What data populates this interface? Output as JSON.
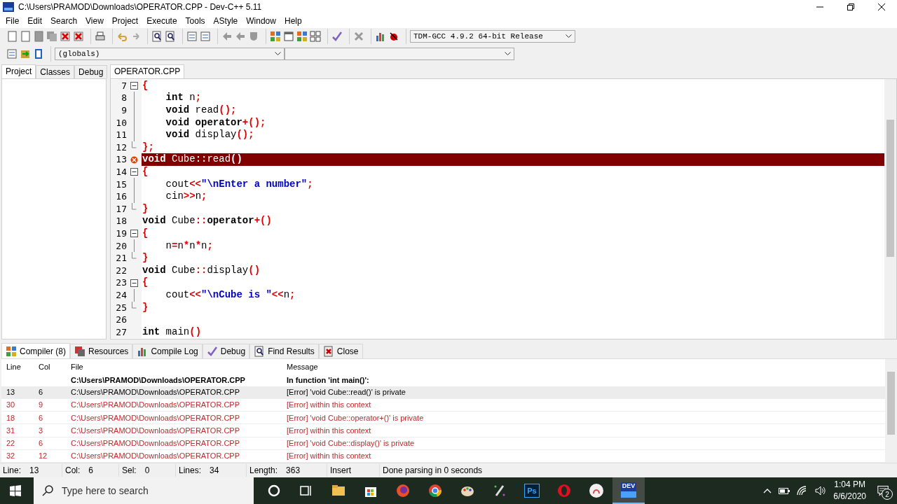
{
  "window": {
    "title": "C:\\Users\\PRAMOD\\Downloads\\OPERATOR.CPP - Dev-C++ 5.11"
  },
  "menu": [
    "File",
    "Edit",
    "Search",
    "View",
    "Project",
    "Execute",
    "Tools",
    "AStyle",
    "Window",
    "Help"
  ],
  "compiler_select": {
    "value": "TDM-GCC 4.9.2 64-bit Release"
  },
  "scope_select": {
    "value": "(globals)"
  },
  "side_tabs": [
    {
      "label": "Project",
      "selected": true
    },
    {
      "label": "Classes",
      "selected": false
    },
    {
      "label": "Debug",
      "selected": false
    }
  ],
  "editor_tabs": [
    {
      "label": "OPERATOR.CPP",
      "selected": true
    }
  ],
  "code_lines": [
    {
      "number": "7",
      "kind": "start",
      "selected": false,
      "tokens": [
        {
          "kind": "sym",
          "text": "{"
        }
      ]
    },
    {
      "number": "8",
      "kind": "mid",
      "selected": false,
      "tokens": [
        {
          "kind": "kw",
          "text": "    int"
        },
        {
          "kind": "plain",
          "text": " n"
        },
        {
          "kind": "sym",
          "text": ";"
        }
      ]
    },
    {
      "number": "9",
      "kind": "mid",
      "selected": false,
      "tokens": [
        {
          "kind": "kw",
          "text": "    void"
        },
        {
          "kind": "plain",
          "text": " read"
        },
        {
          "kind": "sym",
          "text": "();"
        }
      ]
    },
    {
      "number": "10",
      "kind": "mid",
      "selected": false,
      "tokens": [
        {
          "kind": "kw",
          "text": "    void"
        },
        {
          "kind": "kw",
          "text": " operator"
        },
        {
          "kind": "sym",
          "text": "+();"
        }
      ]
    },
    {
      "number": "11",
      "kind": "mid",
      "selected": false,
      "tokens": [
        {
          "kind": "kw",
          "text": "    void"
        },
        {
          "kind": "plain",
          "text": " display"
        },
        {
          "kind": "sym",
          "text": "();"
        }
      ]
    },
    {
      "number": "12",
      "kind": "end",
      "selected": false,
      "tokens": [
        {
          "kind": "sym",
          "text": "};"
        }
      ]
    },
    {
      "number": "13",
      "kind": "plain",
      "selected": true,
      "error": true,
      "tokens": [
        {
          "kind": "kw",
          "text": "void"
        },
        {
          "kind": "plain",
          "text": " Cube"
        },
        {
          "kind": "sym",
          "text": "::"
        },
        {
          "kind": "plain",
          "text": "read"
        },
        {
          "kind": "sym",
          "text": "()"
        }
      ]
    },
    {
      "number": "14",
      "kind": "start",
      "selected": false,
      "tokens": [
        {
          "kind": "sym",
          "text": "{"
        }
      ]
    },
    {
      "number": "15",
      "kind": "mid",
      "selected": false,
      "tokens": [
        {
          "kind": "plain",
          "text": "    cout"
        },
        {
          "kind": "sym",
          "text": "<<"
        },
        {
          "kind": "str",
          "text": "\"\\nEnter a number\""
        },
        {
          "kind": "sym",
          "text": ";"
        }
      ]
    },
    {
      "number": "16",
      "kind": "mid",
      "selected": false,
      "tokens": [
        {
          "kind": "plain",
          "text": "    cin"
        },
        {
          "kind": "sym",
          "text": ">>"
        },
        {
          "kind": "plain",
          "text": "n"
        },
        {
          "kind": "sym",
          "text": ";"
        }
      ]
    },
    {
      "number": "17",
      "kind": "end",
      "selected": false,
      "tokens": [
        {
          "kind": "sym",
          "text": "}"
        }
      ]
    },
    {
      "number": "18",
      "kind": "plain",
      "selected": false,
      "tokens": [
        {
          "kind": "kw",
          "text": "void"
        },
        {
          "kind": "plain",
          "text": " Cube"
        },
        {
          "kind": "sym",
          "text": "::"
        },
        {
          "kind": "kw",
          "text": "operator"
        },
        {
          "kind": "sym",
          "text": "+()"
        }
      ]
    },
    {
      "number": "19",
      "kind": "start",
      "selected": false,
      "tokens": [
        {
          "kind": "sym",
          "text": "{"
        }
      ]
    },
    {
      "number": "20",
      "kind": "mid",
      "selected": false,
      "tokens": [
        {
          "kind": "plain",
          "text": "    n"
        },
        {
          "kind": "sym",
          "text": "="
        },
        {
          "kind": "plain",
          "text": "n"
        },
        {
          "kind": "sym",
          "text": "*"
        },
        {
          "kind": "plain",
          "text": "n"
        },
        {
          "kind": "sym",
          "text": "*"
        },
        {
          "kind": "plain",
          "text": "n"
        },
        {
          "kind": "sym",
          "text": ";"
        }
      ]
    },
    {
      "number": "21",
      "kind": "end",
      "selected": false,
      "tokens": [
        {
          "kind": "sym",
          "text": "}"
        }
      ]
    },
    {
      "number": "22",
      "kind": "plain",
      "selected": false,
      "tokens": [
        {
          "kind": "kw",
          "text": "void"
        },
        {
          "kind": "plain",
          "text": " Cube"
        },
        {
          "kind": "sym",
          "text": "::"
        },
        {
          "kind": "plain",
          "text": "display"
        },
        {
          "kind": "sym",
          "text": "()"
        }
      ]
    },
    {
      "number": "23",
      "kind": "start",
      "selected": false,
      "tokens": [
        {
          "kind": "sym",
          "text": "{"
        }
      ]
    },
    {
      "number": "24",
      "kind": "mid",
      "selected": false,
      "tokens": [
        {
          "kind": "plain",
          "text": "    cout"
        },
        {
          "kind": "sym",
          "text": "<<"
        },
        {
          "kind": "str",
          "text": "\"\\nCube is \""
        },
        {
          "kind": "sym",
          "text": "<<"
        },
        {
          "kind": "plain",
          "text": "n"
        },
        {
          "kind": "sym",
          "text": ";"
        }
      ]
    },
    {
      "number": "25",
      "kind": "end",
      "selected": false,
      "tokens": [
        {
          "kind": "sym",
          "text": "}"
        }
      ]
    },
    {
      "number": "26",
      "kind": "plain",
      "selected": false
    },
    {
      "number": "27",
      "kind": "plain",
      "selected": false,
      "tokens": [
        {
          "kind": "kw",
          "text": "int"
        },
        {
          "kind": "plain",
          "text": " main"
        },
        {
          "kind": "sym",
          "text": "()"
        }
      ]
    }
  ],
  "bottom_tabs": [
    {
      "label": "Compiler (8)",
      "selected": true
    },
    {
      "label": "Resources",
      "selected": false
    },
    {
      "label": "Compile Log",
      "selected": false
    },
    {
      "label": "Debug",
      "selected": false
    },
    {
      "label": "Find Results",
      "selected": false
    },
    {
      "label": "Close",
      "selected": false
    }
  ],
  "messages": {
    "columns": [
      "Line",
      "Col",
      "File",
      "Message"
    ],
    "rows": [
      {
        "kind": "header",
        "file": "C:\\Users\\PRAMOD\\Downloads\\OPERATOR.CPP",
        "message": "In function 'int main()':",
        "selected": false
      },
      {
        "kind": "error",
        "line": "13",
        "col": "6",
        "file": "C:\\Users\\PRAMOD\\Downloads\\OPERATOR.CPP",
        "message": "[Error] 'void Cube::read()' is private",
        "selected": true
      },
      {
        "kind": "error",
        "line": "30",
        "col": "9",
        "file": "C:\\Users\\PRAMOD\\Downloads\\OPERATOR.CPP",
        "message": "[Error] within this context",
        "selected": false
      },
      {
        "kind": "error",
        "line": "18",
        "col": "6",
        "file": "C:\\Users\\PRAMOD\\Downloads\\OPERATOR.CPP",
        "message": "[Error] 'void Cube::operator+()' is private",
        "selected": false
      },
      {
        "kind": "error",
        "line": "31",
        "col": "3",
        "file": "C:\\Users\\PRAMOD\\Downloads\\OPERATOR.CPP",
        "message": "[Error] within this context",
        "selected": false
      },
      {
        "kind": "error",
        "line": "22",
        "col": "6",
        "file": "C:\\Users\\PRAMOD\\Downloads\\OPERATOR.CPP",
        "message": "[Error] 'void Cube::display()' is private",
        "selected": false
      },
      {
        "kind": "error",
        "line": "32",
        "col": "12",
        "file": "C:\\Users\\PRAMOD\\Downloads\\OPERATOR.CPP",
        "message": "[Error] within this context",
        "selected": false
      }
    ]
  },
  "status_bar": [
    {
      "label": "Line:",
      "value": "13"
    },
    {
      "label": "Col:",
      "value": "6"
    },
    {
      "label": "Sel:",
      "value": "0"
    },
    {
      "label": "Lines:",
      "value": "34"
    },
    {
      "label": "Length:",
      "value": "363"
    },
    {
      "value": "Insert"
    },
    {
      "value": "Done parsing in 0 seconds"
    }
  ],
  "taskbar": {
    "search": {
      "placeholder": "Type here to search"
    },
    "apps": [
      {
        "kind": "cortana",
        "selected": false
      },
      {
        "kind": "taskview",
        "selected": false
      },
      {
        "kind": "folder",
        "selected": false
      },
      {
        "kind": "store",
        "selected": false
      },
      {
        "kind": "firefox",
        "selected": false
      },
      {
        "kind": "chrome",
        "selected": false
      },
      {
        "kind": "paint",
        "selected": false
      },
      {
        "kind": "hp",
        "selected": false
      },
      {
        "kind": "ps",
        "selected": false
      },
      {
        "kind": "opera",
        "selected": false
      },
      {
        "kind": "circle-app",
        "selected": false
      },
      {
        "kind": "devcpp",
        "selected": true
      }
    ],
    "ps_label": "Ps",
    "dev_label": "DEV",
    "time": "1:04 PM",
    "date": "6/6/2020",
    "notifications": "2"
  }
}
